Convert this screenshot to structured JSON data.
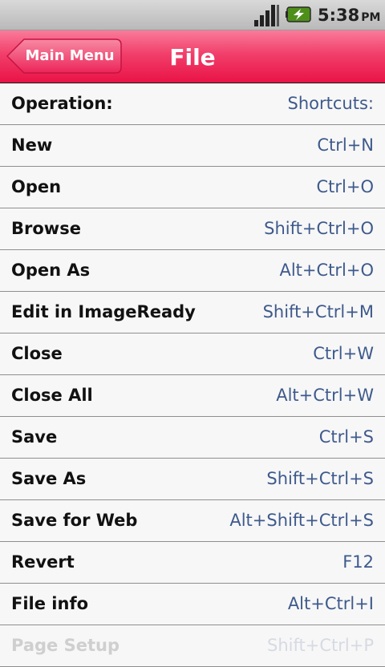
{
  "status_bar": {
    "time": "5:38",
    "ampm": "PM",
    "signal_icon": "signal-bars-icon",
    "battery_icon": "battery-charging-icon"
  },
  "header": {
    "back_label": "Main Menu",
    "title": "File"
  },
  "colors": {
    "accent": "#e91347",
    "shortcut_text": "#3e5a8c"
  },
  "list": {
    "header": {
      "operation": "Operation:",
      "shortcut": "Shortcuts:"
    },
    "items": [
      {
        "operation": "New",
        "shortcut": "Ctrl+N"
      },
      {
        "operation": "Open",
        "shortcut": "Ctrl+O"
      },
      {
        "operation": "Browse",
        "shortcut": "Shift+Ctrl+O"
      },
      {
        "operation": "Open As",
        "shortcut": "Alt+Ctrl+O"
      },
      {
        "operation": "Edit in ImageReady",
        "shortcut": "Shift+Ctrl+M"
      },
      {
        "operation": "Close",
        "shortcut": "Ctrl+W"
      },
      {
        "operation": "Close All",
        "shortcut": "Alt+Ctrl+W"
      },
      {
        "operation": "Save",
        "shortcut": "Ctrl+S"
      },
      {
        "operation": "Save As",
        "shortcut": "Shift+Ctrl+S"
      },
      {
        "operation": "Save for Web",
        "shortcut": "Alt+Shift+Ctrl+S"
      },
      {
        "operation": "Revert",
        "shortcut": "F12"
      },
      {
        "operation": "File info",
        "shortcut": "Alt+Ctrl+I"
      },
      {
        "operation": "Page Setup",
        "shortcut": "Shift+Ctrl+P"
      }
    ]
  }
}
